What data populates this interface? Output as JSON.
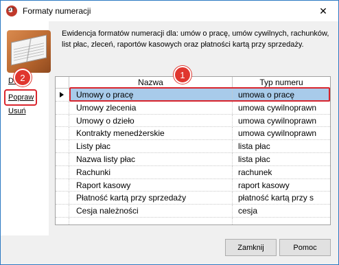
{
  "window": {
    "title": "Formaty numeracji"
  },
  "description": "Ewidencja formatów numeracji dla: umów o pracę, umów cywilnych, rachunków, list płac, zleceń, raportów kasowych oraz płatności kartą przy sprzedaży.",
  "side_links": {
    "add": "Dodaj",
    "edit": "Popraw",
    "delete": "Usuń"
  },
  "annotations": {
    "badge1": "1",
    "badge2": "2"
  },
  "grid": {
    "columns": [
      "Nazwa",
      "Typ numeru"
    ],
    "rows": [
      {
        "name": "Umowy o pracę",
        "type": "umowa o pracę",
        "selected": true
      },
      {
        "name": "Umowy zlecenia",
        "type": "umowa cywilnoprawn"
      },
      {
        "name": "Umowy o dzieło",
        "type": "umowa cywilnoprawn"
      },
      {
        "name": "Kontrakty menedżerskie",
        "type": "umowa cywilnoprawn"
      },
      {
        "name": "Listy płac",
        "type": "lista płac"
      },
      {
        "name": "Nazwa listy płac",
        "type": "lista płac"
      },
      {
        "name": "Rachunki",
        "type": "rachunek"
      },
      {
        "name": "Raport kasowy",
        "type": "raport kasowy"
      },
      {
        "name": "Płatność kartą przy sprzedaży",
        "type": "płatność kartą przy s"
      },
      {
        "name": "Cesja należności",
        "type": "cesja"
      },
      {
        "name": "",
        "type": ""
      }
    ]
  },
  "buttons": {
    "close": "Zamknij",
    "help": "Pomoc"
  },
  "colors": {
    "highlight": "#d9242c",
    "selection": "#a8cbea",
    "badge": "#e0362f"
  }
}
